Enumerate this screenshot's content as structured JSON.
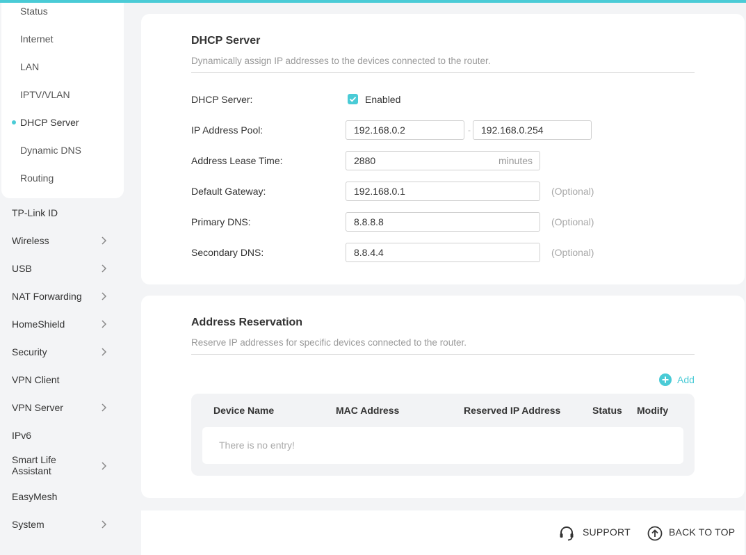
{
  "colors": {
    "accent": "#4acbd6",
    "background": "#f3f4f6"
  },
  "sidebar": {
    "submenu": [
      {
        "label": "Status"
      },
      {
        "label": "Internet"
      },
      {
        "label": "LAN"
      },
      {
        "label": "IPTV/VLAN"
      },
      {
        "label": "DHCP Server",
        "active": true
      },
      {
        "label": "Dynamic DNS"
      },
      {
        "label": "Routing"
      }
    ],
    "menu": [
      {
        "label": "TP-Link ID"
      },
      {
        "label": "Wireless",
        "icon": "chevron-right-icon"
      },
      {
        "label": "USB",
        "icon": "chevron-right-icon"
      },
      {
        "label": "NAT Forwarding",
        "icon": "chevron-right-icon"
      },
      {
        "label": "HomeShield",
        "icon": "chevron-right-icon"
      },
      {
        "label": "Security",
        "icon": "chevron-right-icon"
      },
      {
        "label": "VPN Client"
      },
      {
        "label": "VPN Server",
        "icon": "chevron-right-icon"
      },
      {
        "label": "IPv6"
      },
      {
        "label": "Smart Life Assistant",
        "line1": "Smart Life",
        "line2": "Assistant",
        "icon": "chevron-right-icon"
      },
      {
        "label": "EasyMesh"
      },
      {
        "label": "System",
        "icon": "chevron-right-icon"
      }
    ]
  },
  "dhcp": {
    "title": "DHCP Server",
    "description": "Dynamically assign IP addresses to the devices connected to the router.",
    "server_label": "DHCP Server:",
    "enabled_label": "Enabled",
    "enabled": true,
    "pool_label": "IP Address Pool:",
    "pool_start": "192.168.0.2",
    "pool_separator": "-",
    "pool_end": "192.168.0.254",
    "lease_label": "Address Lease Time:",
    "lease_value": "2880",
    "lease_unit": "minutes",
    "gateway_label": "Default Gateway:",
    "gateway_value": "192.168.0.1",
    "primary_dns_label": "Primary DNS:",
    "primary_dns_value": "8.8.8.8",
    "secondary_dns_label": "Secondary DNS:",
    "secondary_dns_value": "8.8.4.4",
    "optional": "(Optional)"
  },
  "reservation": {
    "title": "Address Reservation",
    "description": "Reserve IP addresses for specific devices connected to the router.",
    "add_label": "Add",
    "columns": [
      "Device Name",
      "MAC Address",
      "Reserved IP Address",
      "Status",
      "Modify"
    ],
    "empty_text": "There is no entry!"
  },
  "footer": {
    "support_label": "SUPPORT",
    "back_to_top_label": "BACK TO TOP"
  }
}
